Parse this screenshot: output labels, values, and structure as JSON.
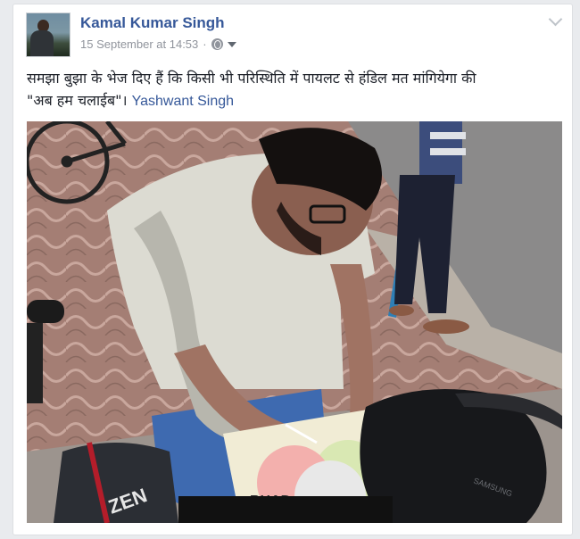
{
  "post": {
    "author": "Kamal Kumar Singh",
    "timestamp": "15 September at 14:53",
    "separator": "·",
    "privacy_icon": "globe-icon",
    "audience_caret_icon": "caret-down-icon",
    "options_icon": "chevron-down-icon",
    "text_line1": "समझा बुझा के भेज दिए हैं कि किसी भी परिस्थिति में पायलट से हंडिल मत मांगियेगा की",
    "text_line2": "\"अब हम चलाईब\"। ",
    "mention": "Yashwant Singh"
  },
  "photo": {
    "bag_brand": "SAMSUNG",
    "paper_text": "BHAD",
    "backpack_text": "ZEN",
    "colors": {
      "pavement": "#a47e74",
      "shirt": "#dcdbd2",
      "jeans": "#3e6ab0",
      "bag": "#17181b"
    }
  },
  "colors": {
    "link": "#365899",
    "meta": "#90949c",
    "page_bg": "#e9ebee"
  }
}
